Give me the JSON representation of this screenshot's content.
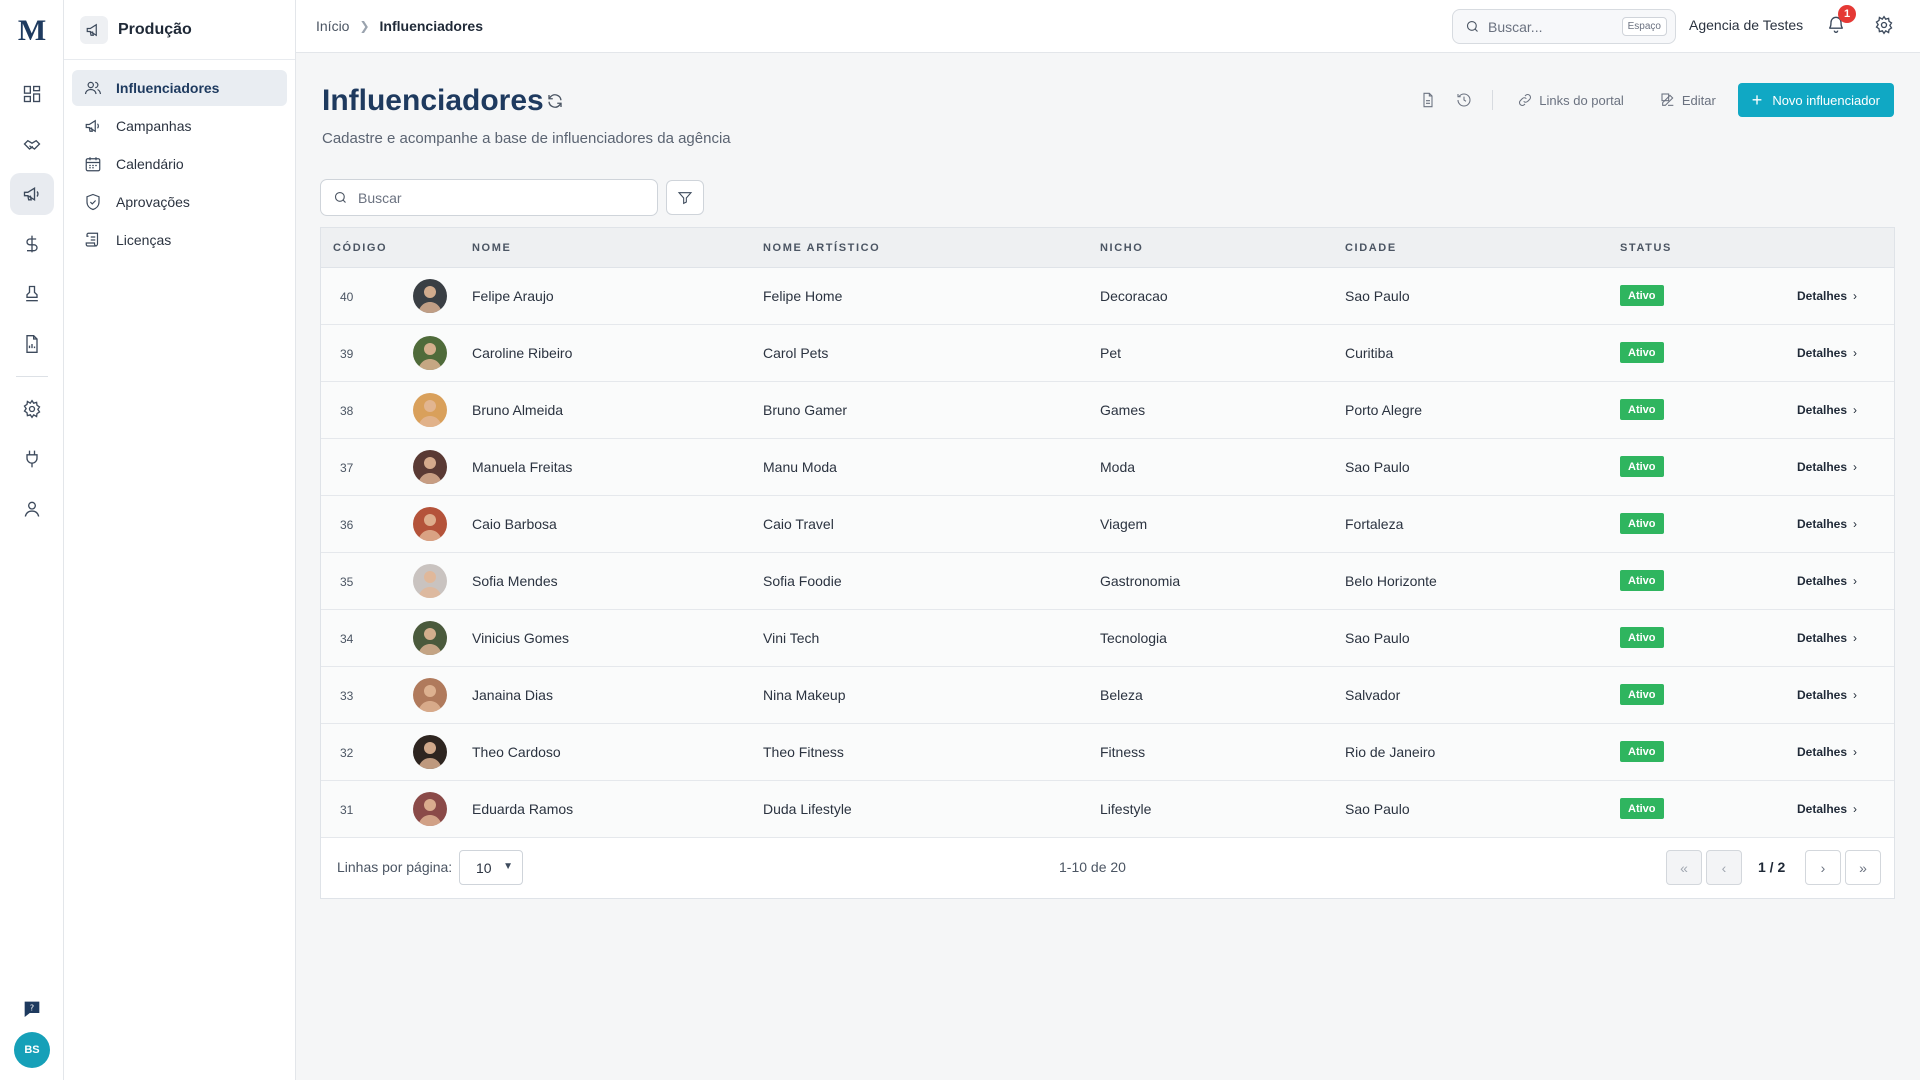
{
  "app": {
    "logo": "M",
    "user_initials": "BS"
  },
  "section": {
    "title": "Produção"
  },
  "sidebar": {
    "items": [
      {
        "label": "Influenciadores",
        "icon": "users-icon",
        "active": true
      },
      {
        "label": "Campanhas",
        "icon": "megaphone-icon",
        "active": false
      },
      {
        "label": "Calendário",
        "icon": "calendar-icon",
        "active": false
      },
      {
        "label": "Aprovações",
        "icon": "shield-check-icon",
        "active": false
      },
      {
        "label": "Licenças",
        "icon": "scroll-icon",
        "active": false
      }
    ]
  },
  "rail": {
    "items": [
      "dashboard-icon",
      "handshake-icon",
      "megaphone-icon",
      "dollar-icon",
      "stamp-icon",
      "report-icon",
      "gear-icon",
      "plug-icon",
      "user-icon"
    ],
    "help_icon": "help-chat-icon"
  },
  "topbar": {
    "breadcrumb_home": "Início",
    "breadcrumb_current": "Influenciadores",
    "search_placeholder": "Buscar...",
    "search_shortcut": "Espaço",
    "agency": "Agencia de Testes",
    "notification_count": "1"
  },
  "page": {
    "title": "Influenciadores",
    "subtitle": "Cadastre e acompanhe a base de influenciadores da agência",
    "actions": {
      "portal_links": "Links do portal",
      "edit": "Editar",
      "new_button": "Novo influenciador"
    },
    "search_placeholder": "Buscar"
  },
  "table": {
    "columns": {
      "code": "CÓDIGO",
      "name": "NOME",
      "artistic": "NOME ARTÍSTICO",
      "niche": "NICHO",
      "city": "CIDADE",
      "status": "STATUS"
    },
    "details_label": "Detalhes",
    "rows": [
      {
        "code": "40",
        "name": "Felipe Araujo",
        "artistic": "Felipe Home",
        "niche": "Decoracao",
        "city": "Sao Paulo",
        "status": "Ativo",
        "avatar_color": "#3a3f44"
      },
      {
        "code": "39",
        "name": "Caroline Ribeiro",
        "artistic": "Carol Pets",
        "niche": "Pet",
        "city": "Curitiba",
        "status": "Ativo",
        "avatar_color": "#4f6b3a"
      },
      {
        "code": "38",
        "name": "Bruno Almeida",
        "artistic": "Bruno Gamer",
        "niche": "Games",
        "city": "Porto Alegre",
        "status": "Ativo",
        "avatar_color": "#d9a05b"
      },
      {
        "code": "37",
        "name": "Manuela Freitas",
        "artistic": "Manu Moda",
        "niche": "Moda",
        "city": "Sao Paulo",
        "status": "Ativo",
        "avatar_color": "#5a3a34"
      },
      {
        "code": "36",
        "name": "Caio Barbosa",
        "artistic": "Caio Travel",
        "niche": "Viagem",
        "city": "Fortaleza",
        "status": "Ativo",
        "avatar_color": "#b4533a"
      },
      {
        "code": "35",
        "name": "Sofia Mendes",
        "artistic": "Sofia Foodie",
        "niche": "Gastronomia",
        "city": "Belo Horizonte",
        "status": "Ativo",
        "avatar_color": "#c9c3c0"
      },
      {
        "code": "34",
        "name": "Vinicius Gomes",
        "artistic": "Vini Tech",
        "niche": "Tecnologia",
        "city": "Sao Paulo",
        "status": "Ativo",
        "avatar_color": "#4a5a3c"
      },
      {
        "code": "33",
        "name": "Janaina Dias",
        "artistic": "Nina Makeup",
        "niche": "Beleza",
        "city": "Salvador",
        "status": "Ativo",
        "avatar_color": "#b07a5c"
      },
      {
        "code": "32",
        "name": "Theo Cardoso",
        "artistic": "Theo Fitness",
        "niche": "Fitness",
        "city": "Rio de Janeiro",
        "status": "Ativo",
        "avatar_color": "#2e2520"
      },
      {
        "code": "31",
        "name": "Eduarda Ramos",
        "artistic": "Duda Lifestyle",
        "niche": "Lifestyle",
        "city": "Sao Paulo",
        "status": "Ativo",
        "avatar_color": "#8a4a48"
      }
    ]
  },
  "pagination": {
    "rows_label": "Linhas por página:",
    "rows_value": "10",
    "range": "1-10 de 20",
    "page_info": "1 / 2"
  },
  "colors": {
    "primary": "#10a8c4",
    "status_active": "#2fb55f",
    "title": "#1e3a5f",
    "notification": "#e53935"
  }
}
